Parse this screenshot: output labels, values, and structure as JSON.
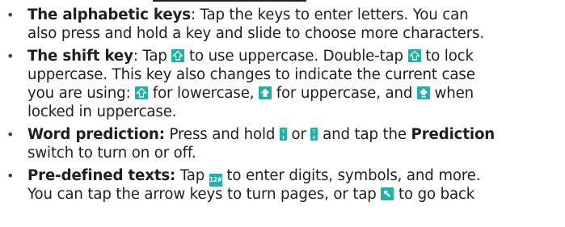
{
  "items": [
    {
      "term": "The alphabetic keys",
      "lines": [
        [
          ": Tap the keys to enter letters. You can"
        ],
        [
          "also press and hold a key and slide to choose more characters."
        ]
      ]
    },
    {
      "term": "The shift key",
      "l1a": ": Tap ",
      "l1b": " to use uppercase. Double-tap ",
      "l1c": " to lock",
      "l2": "uppercase. This key also changes to indicate the current case",
      "l3a": "you are using: ",
      "l3b": " for lowercase, ",
      "l3c": " for uppercase, and ",
      "l3d": " when",
      "l4": "locked in uppercase."
    },
    {
      "term": "Word prediction:",
      "l1a": " Press and hold ",
      "l1b": " or ",
      "l1c": " and tap the ",
      "l1d": "Prediction",
      "l2": "switch to turn on or off."
    },
    {
      "term": "Pre-defined texts:",
      "l1a": " Tap ",
      "l1b": " to enter digits, symbols, and more.",
      "l2a": "You can tap the arrow keys to turn pages, or tap ",
      "l2b": " to go back"
    }
  ],
  "bullet": "•",
  "key_label_symbols": "12#",
  "colors": {
    "key_background": "#1bb3a7",
    "key_glyph": "#ffffff"
  },
  "icons": {
    "shift": "shift-outline-icon",
    "shift_filled": "shift-filled-icon",
    "shift_locked": "shift-locked-icon",
    "comma_key": "comma-key-icon",
    "symbols_key": "symbols-key-icon",
    "back": "back-arrow-icon"
  }
}
